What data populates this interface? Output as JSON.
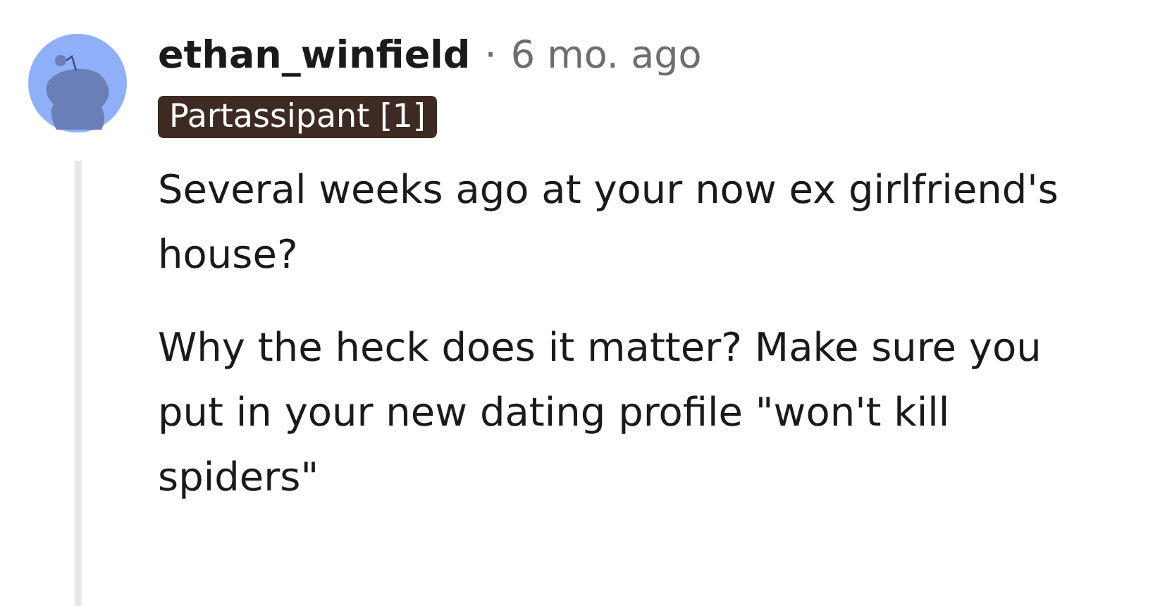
{
  "comment": {
    "author": "ethan_winfield",
    "separator": "·",
    "time": "6 mo. ago",
    "flair": "Partassipant [1]",
    "paragraphs": [
      "Several weeks ago at your now ex girlfriend's house?",
      "Why the heck does it matter? Make sure you put in your new dating profile \"won't kill spiders\""
    ]
  }
}
